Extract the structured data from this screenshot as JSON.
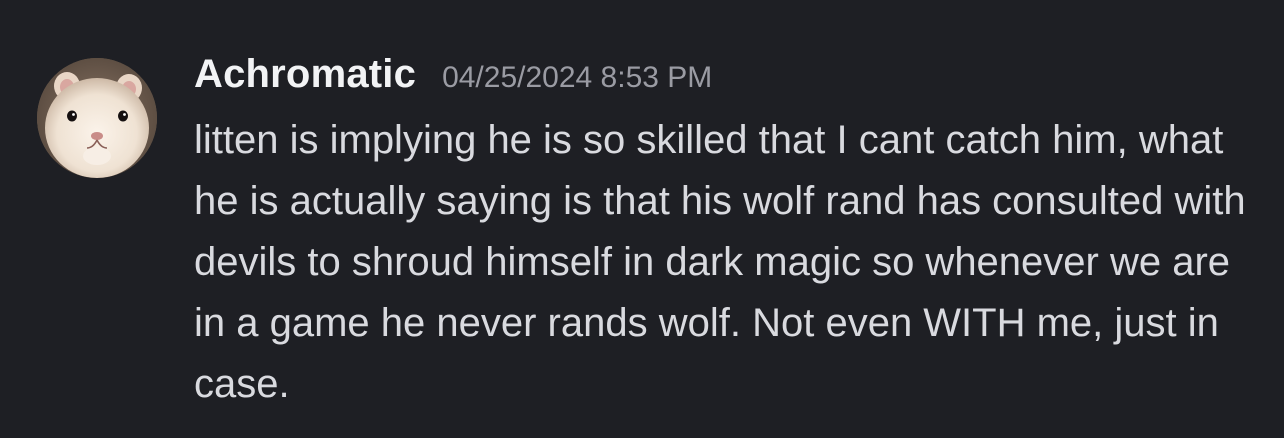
{
  "message": {
    "author": "Achromatic",
    "timestamp": "04/25/2024 8:53 PM",
    "avatar_icon": "hamster-avatar-icon",
    "text": "litten is implying he is so skilled that I cant catch him, what he is actually saying is that his wolf rand has consulted with devils to shroud himself in dark magic so whenever we are in a game he never rands wolf. Not even WITH me, just in case."
  },
  "colors": {
    "background": "#1e1f24",
    "username": "#f2f3f5",
    "timestamp": "#9a9ba3",
    "message_text": "#d9dadf"
  }
}
